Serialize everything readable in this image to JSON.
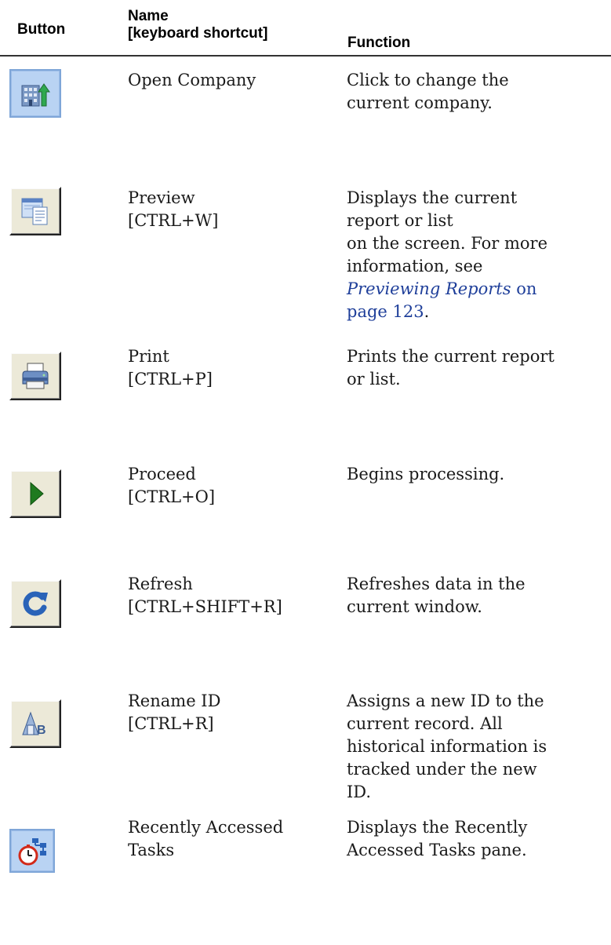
{
  "header": {
    "button": "Button",
    "name_line1": "Name",
    "name_line2": "[keyboard shortcut]",
    "function": "Function"
  },
  "rows": [
    {
      "icon": "open-company-icon",
      "name": "Open Company",
      "shortcut": "",
      "function_lines": [
        "Click to change the",
        "current company."
      ]
    },
    {
      "icon": "preview-icon",
      "name": "Preview",
      "shortcut": "[CTRL+W]",
      "function_lines": [
        "Displays the current",
        "report or list",
        "on the screen. For more",
        "information, see"
      ],
      "link_title": "Previewing Reports",
      "link_on": "on",
      "link_page": "page 123",
      "link_end": "."
    },
    {
      "icon": "print-icon",
      "name": "Print",
      "shortcut": "[CTRL+P]",
      "function_lines": [
        "Prints the current report",
        "or list."
      ]
    },
    {
      "icon": "proceed-icon",
      "name": "Proceed",
      "shortcut": "[CTRL+O]",
      "function_lines": [
        "Begins processing."
      ]
    },
    {
      "icon": "refresh-icon",
      "name": "Refresh",
      "shortcut": "[CTRL+SHIFT+R]",
      "function_lines": [
        "Refreshes data in the",
        "current window."
      ]
    },
    {
      "icon": "rename-id-icon",
      "name": "Rename ID",
      "shortcut": "[CTRL+R]",
      "function_lines": [
        "Assigns a new ID to the",
        "current record. All",
        "historical information is",
        "tracked under the new",
        "ID."
      ]
    },
    {
      "icon": "recently-accessed-tasks-icon",
      "name_lines": [
        "Recently Accessed",
        "Tasks"
      ],
      "function_lines": [
        "Displays the Recently",
        "Accessed Tasks pane."
      ]
    }
  ]
}
